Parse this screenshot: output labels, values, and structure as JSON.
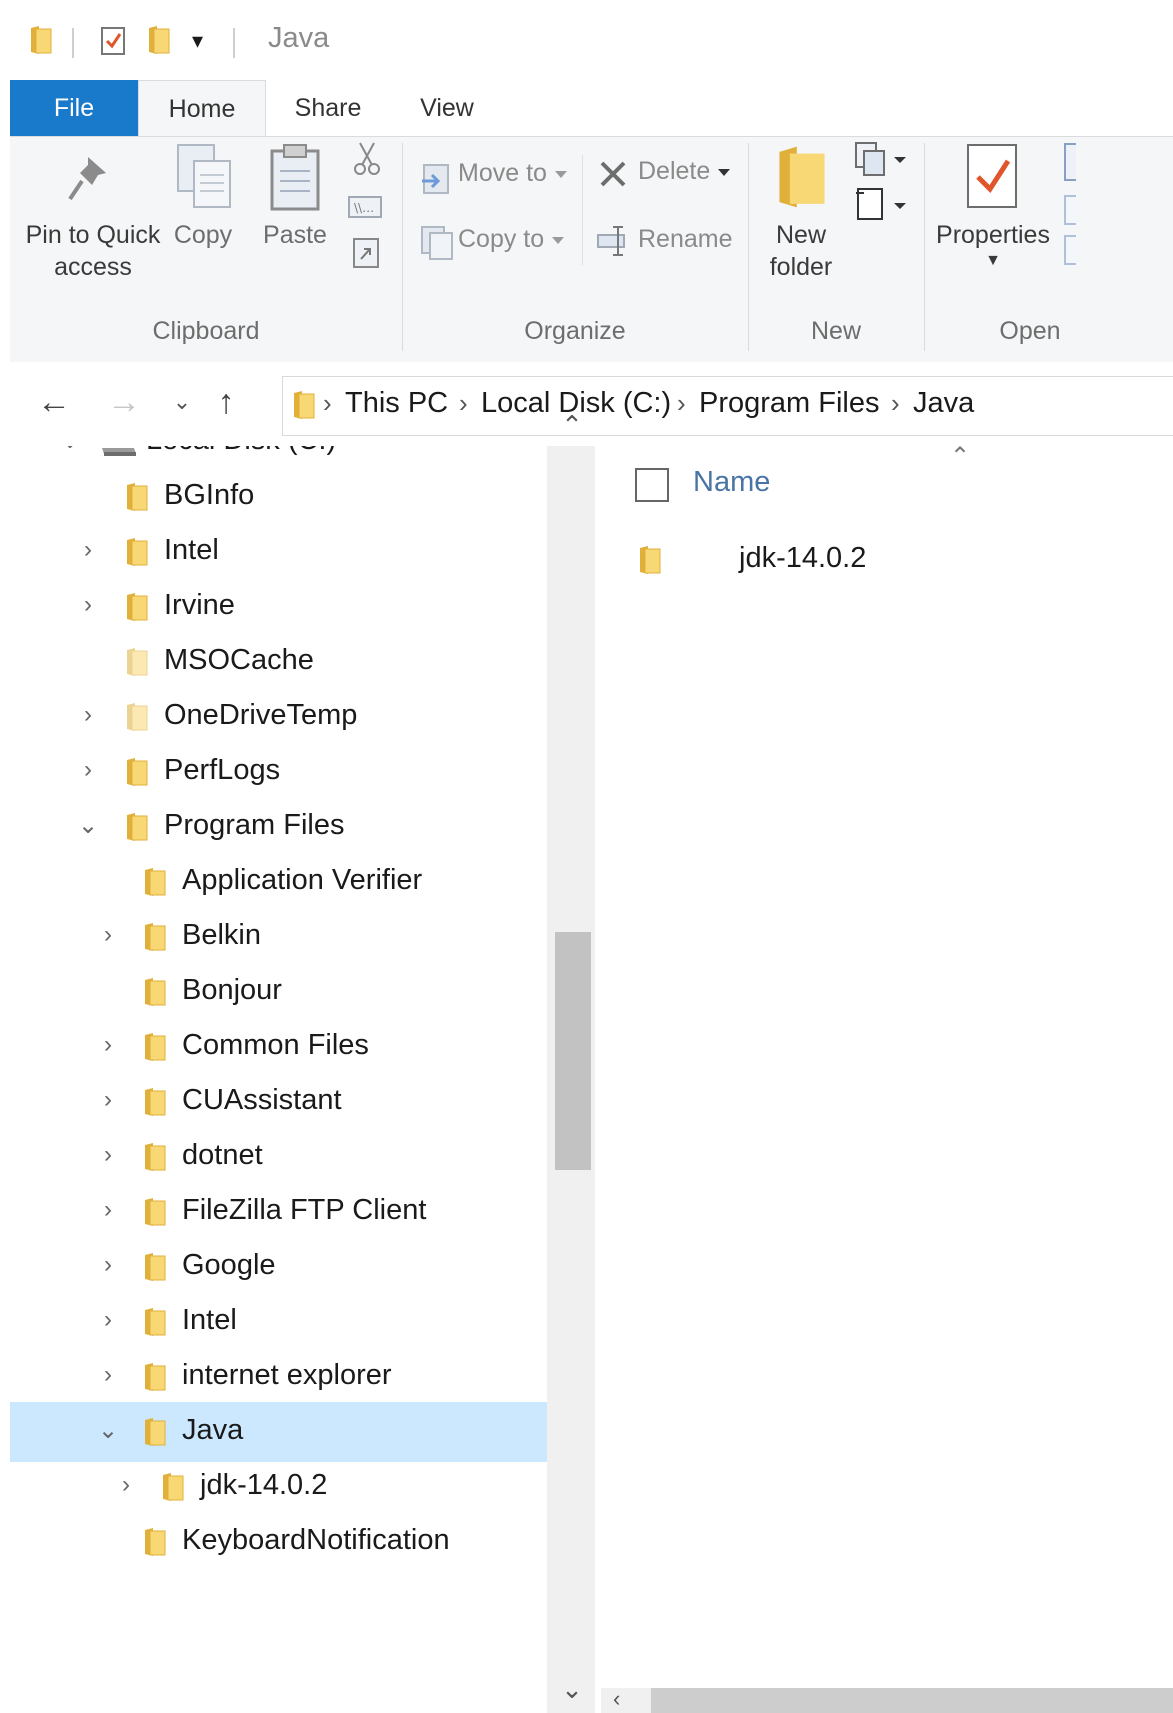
{
  "window": {
    "title": "Java"
  },
  "tabs": [
    "File",
    "Home",
    "Share",
    "View"
  ],
  "ribbon": {
    "clipboard": {
      "pin_label_1": "Pin to Quick",
      "pin_label_2": "access",
      "copy": "Copy",
      "paste": "Paste",
      "group": "Clipboard"
    },
    "organize": {
      "move_to": "Move to",
      "copy_to": "Copy to",
      "delete": "Delete",
      "rename": "Rename",
      "group": "Organize"
    },
    "new": {
      "new_folder_1": "New",
      "new_folder_2": "folder",
      "group": "New"
    },
    "open": {
      "properties": "Properties",
      "group": "Open"
    }
  },
  "address": {
    "crumbs": [
      "This PC",
      "Local Disk (C:)",
      "Program Files",
      "Java"
    ]
  },
  "tree": [
    {
      "label": "Local Disk (C:)",
      "state": "expanded"
    },
    {
      "label": "BGInfo",
      "state": "none"
    },
    {
      "label": "Intel",
      "state": "collapsed"
    },
    {
      "label": "Irvine",
      "state": "collapsed"
    },
    {
      "label": "MSOCache",
      "state": "none"
    },
    {
      "label": "OneDriveTemp",
      "state": "collapsed"
    },
    {
      "label": "PerfLogs",
      "state": "collapsed"
    },
    {
      "label": "Program Files",
      "state": "expanded"
    },
    {
      "label": "Application Verifier",
      "state": "none"
    },
    {
      "label": "Belkin",
      "state": "collapsed"
    },
    {
      "label": "Bonjour",
      "state": "none"
    },
    {
      "label": "Common Files",
      "state": "collapsed"
    },
    {
      "label": "CUAssistant",
      "state": "collapsed"
    },
    {
      "label": "dotnet",
      "state": "collapsed"
    },
    {
      "label": "FileZilla FTP Client",
      "state": "collapsed"
    },
    {
      "label": "Google",
      "state": "collapsed"
    },
    {
      "label": "Intel",
      "state": "collapsed"
    },
    {
      "label": "internet explorer",
      "state": "collapsed"
    },
    {
      "label": "Java",
      "state": "expanded",
      "selected": true
    },
    {
      "label": "jdk-14.0.2",
      "state": "collapsed"
    },
    {
      "label": "KeyboardNotification",
      "state": "none"
    }
  ],
  "content": {
    "column_name": "Name",
    "files": [
      {
        "name": "jdk-14.0.2",
        "type": "folder"
      }
    ]
  },
  "colors": {
    "accent": "#1979ca",
    "selection": "#cce8ff",
    "folder": "#f8d775"
  }
}
